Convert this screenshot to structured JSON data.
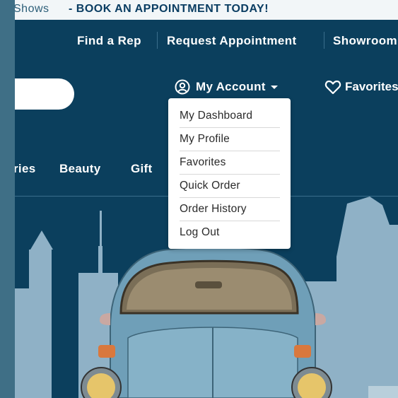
{
  "announcement": {
    "prefix": "Shows",
    "text": "- BOOK AN APPOINTMENT TODAY!"
  },
  "top_nav": {
    "items": [
      {
        "label": "Find a Rep"
      },
      {
        "label": "Request Appointment"
      },
      {
        "label": "Showroom"
      }
    ]
  },
  "header": {
    "account_label": "My Account",
    "favorites_label": "Favorites"
  },
  "account_menu": {
    "items": [
      {
        "label": "My Dashboard"
      },
      {
        "label": "My Profile"
      },
      {
        "label": "Favorites"
      },
      {
        "label": "Quick Order"
      },
      {
        "label": "Order History"
      },
      {
        "label": "Log Out"
      }
    ]
  },
  "categories": {
    "items": [
      {
        "label": "ries"
      },
      {
        "label": "Beauty"
      },
      {
        "label": "Gift"
      }
    ]
  },
  "colors": {
    "navy": "#0b3f5d",
    "outer": "#3f6f86",
    "skyline": "#8fb1c6",
    "car_body": "#6f9fb8"
  },
  "icons": {
    "account": "user-circle-icon",
    "favorites": "heart-icon",
    "dropdown": "caret-down-icon"
  }
}
